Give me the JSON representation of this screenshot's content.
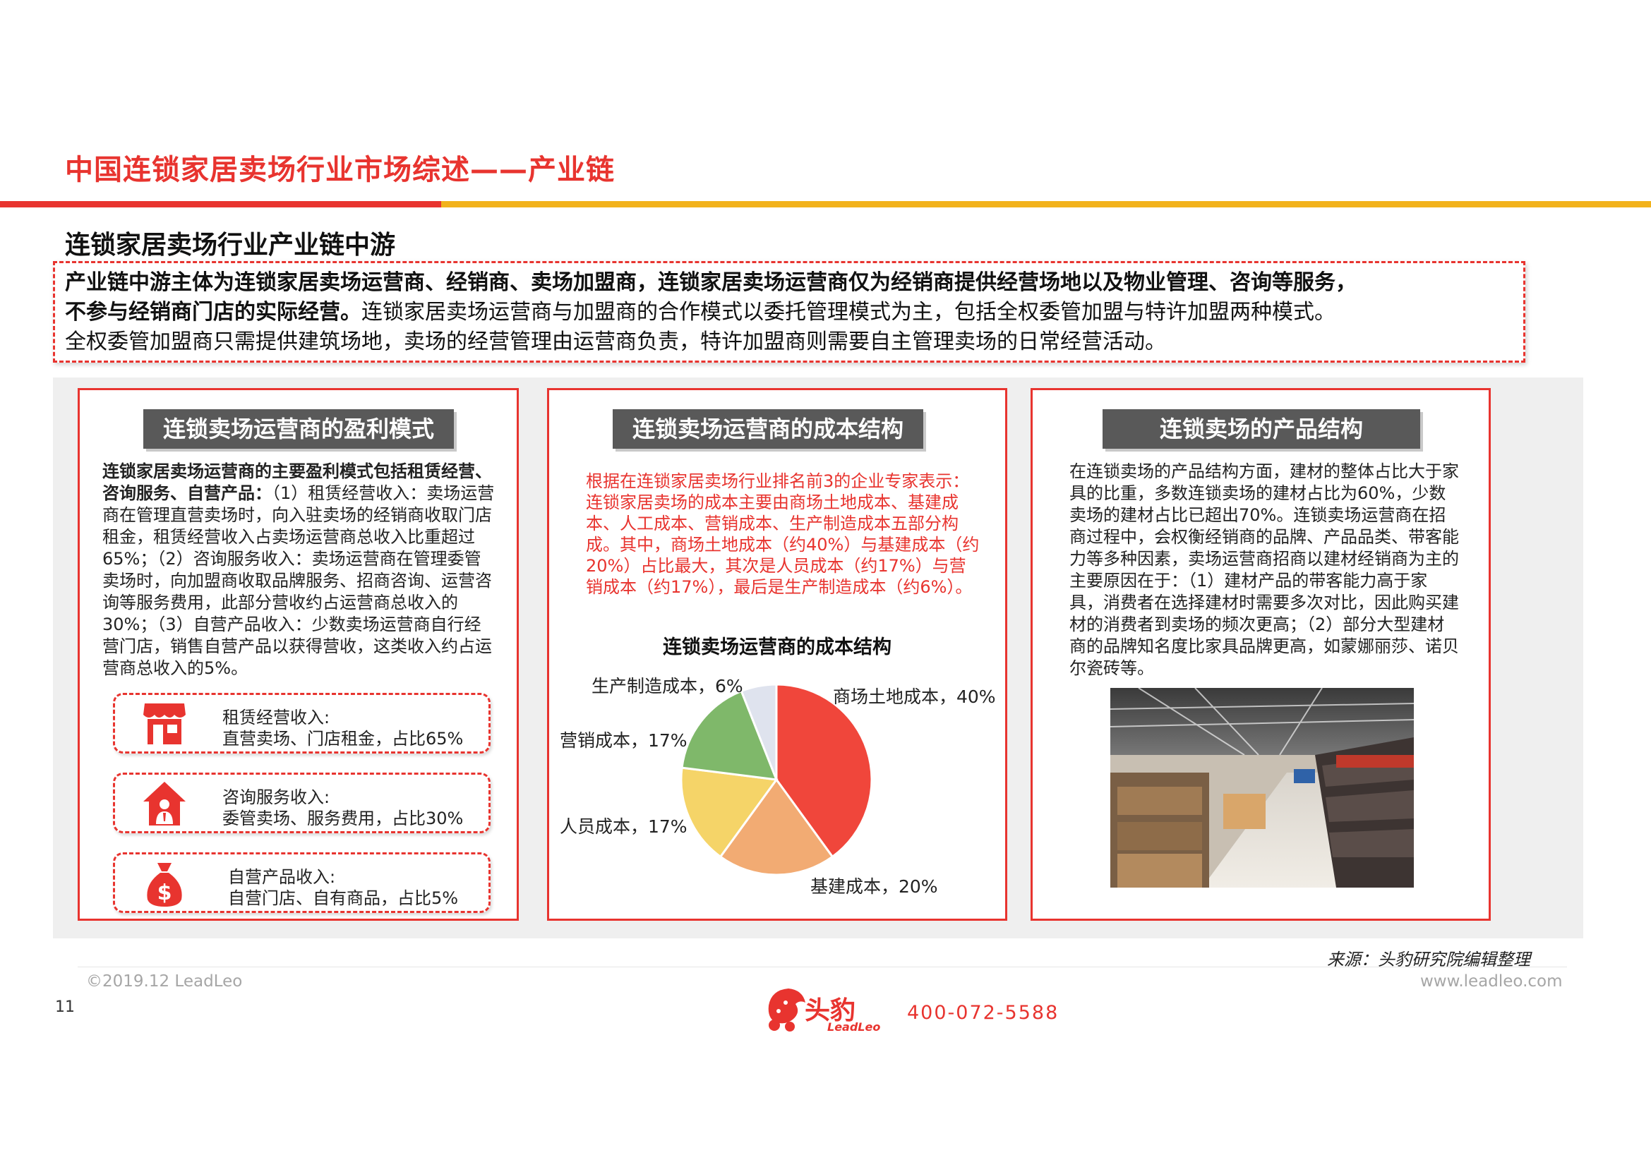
{
  "header": {
    "title": "中国连锁家居卖场行业市场综述——产业链",
    "section_heading": "连锁家居卖场行业产业链中游"
  },
  "summary": {
    "bold_line1": "产业链中游主体为连锁家居卖场运营商、经销商、卖场加盟商，连锁家居卖场运营商仅为经销商提供经营场地以及物业管理、咨询等服务，",
    "bold_line2": "不参与经销商门店的实际经营。",
    "normal_line2": "连锁家居卖场运营商与加盟商的合作模式以委托管理模式为主，包括全权委管加盟与特许加盟两种模式。",
    "line3": "全权委管加盟商只需提供建筑场地，卖场的经营管理由运营商负责，特许加盟商则需要自主管理卖场的日常经营活动。"
  },
  "card1": {
    "title": "连锁卖场运营商的盈利模式",
    "text_bold": "连锁家居卖场运营商的主要盈利模式包括租赁经营、咨询服务、自营产品：",
    "text_normal": "（1）租赁经营收入：卖场运营商在管理直营卖场时，向入驻卖场的经销商收取门店租金，租赁经营收入占卖场运营商总收入比重超过65%；（2）咨询服务收入：卖场运营商在管理委管卖场时，向加盟商收取品牌服务、招商咨询、运营咨询等服务费用，此部分营收约占运营商总收入的30%；（3）自营产品收入：少数卖场运营商自行经营门店，销售自营产品以获得营收，这类收入约占运营商总收入的5%。",
    "revenue": [
      {
        "label": "租赁经营收入:",
        "detail": "直营卖场、门店租金，占比65%",
        "icon": "store-icon"
      },
      {
        "label": "咨询服务收入:",
        "detail": "委管卖场、服务费用，占比30%",
        "icon": "house-person-icon"
      },
      {
        "label": "自营产品收入:",
        "detail": "自营门店、自有商品，占比5%",
        "icon": "money-bag-icon"
      }
    ]
  },
  "card2": {
    "title": "连锁卖场运营商的成本结构",
    "text": "根据在连锁家居卖场行业排名前3的企业专家表示：连锁家居卖场的成本主要由商场土地成本、基建成本、人工成本、营销成本、生产制造成本五部分构成。其中，商场土地成本（约40%）与基建成本（约20%）占比最大，其次是人员成本（约17%）与营销成本（约17%），最后是生产制造成本（约6%）。"
  },
  "chart_data": {
    "type": "pie",
    "title": "连锁卖场运营商的成本结构",
    "slices": [
      {
        "name": "商场土地成本",
        "value": 40,
        "color": "#f0463b",
        "label": "商场土地成本，40%"
      },
      {
        "name": "基建成本",
        "value": 20,
        "color": "#f2ab73",
        "label": "基建成本，20%"
      },
      {
        "name": "人员成本",
        "value": 17,
        "color": "#f5d468",
        "label": "人员成本，17%"
      },
      {
        "name": "营销成本",
        "value": 17,
        "color": "#7fb86a",
        "label": "营销成本，17%"
      },
      {
        "name": "生产制造成本",
        "value": 6,
        "color": "#dfe3ee",
        "label": "生产制造成本，6%"
      }
    ]
  },
  "card3": {
    "title": "连锁卖场的产品结构",
    "text": "在连锁卖场的产品结构方面，建材的整体占比大于家具的比重，多数连锁卖场的建材占比为60%，少数卖场的建材占比已超出70%。连锁卖场运营商在招商过程中，会权衡经销商的品牌、产品品类、带客能力等多种因素，卖场运营商招商以建材经销商为主的主要原因在于：（1）建材产品的带客能力高于家具，消费者在选择建材时需要多次对比，因此购买建材的消费者到卖场的频次更高；（2）部分大型建材商的品牌知名度比家具品牌更高，如蒙娜丽莎、诺贝尔瓷砖等。"
  },
  "footer": {
    "source": "来源：头豹研究院编辑整理",
    "copyright": "©2019.12 LeadLeo",
    "website": "www.leadleo.com",
    "page_number": "11",
    "logo_cn": "头豹",
    "logo_en": "LeadLeo",
    "phone": "400-072-5588"
  }
}
